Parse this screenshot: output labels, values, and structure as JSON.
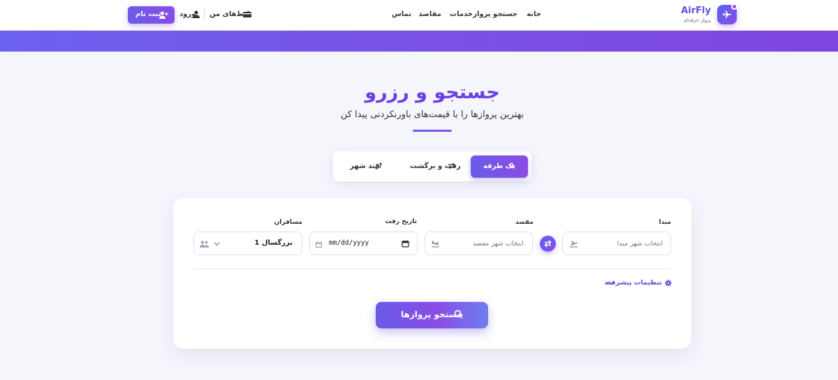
{
  "header": {
    "brand": "AirFly",
    "brand_sub": "پرواز حرفه‌ای",
    "nav": [
      "خانه",
      "جستجو پرواز",
      "خدمات",
      "مقاصد",
      "تماس"
    ],
    "my_tickets": "بلیط‌های من",
    "login": "ورود",
    "register": "ثبت نام"
  },
  "hero": {
    "title": "جستجو و رزرو",
    "subtitle": "بهترین پروازها را با قیمت‌های باورنکردنی پیدا کن"
  },
  "tabs": {
    "one_way": "یک طرفه",
    "round_trip": "رفت و برگشت",
    "multi_city": "چند شهر",
    "active": "one_way"
  },
  "form": {
    "origin_label": "مبدا",
    "origin_placeholder": "انتخاب شهر مبدا",
    "dest_label": "مقصد",
    "dest_placeholder": "انتخاب شهر مقصد",
    "date_label": "تاریخ رفت",
    "date_value": "mm/dd/yyyy",
    "passengers_label": "مسافران",
    "passengers_value": "1 بزرگسال",
    "advanced": "تنظیمات پیشرفته",
    "search": "جستجو پروازها"
  },
  "colors": {
    "accent": "#6c5ce7",
    "accent2": "#8a4ce6",
    "title": "#6c3fe0"
  },
  "icons": [
    "plane-icon",
    "user-plus-icon",
    "user-icon",
    "ticket-icon",
    "arrow-right-icon",
    "swap-icon",
    "route-icon",
    "takeoff-icon",
    "landing-icon",
    "calendar-icon",
    "users-icon",
    "chevron-down-icon",
    "gear-icon",
    "search-icon"
  ]
}
